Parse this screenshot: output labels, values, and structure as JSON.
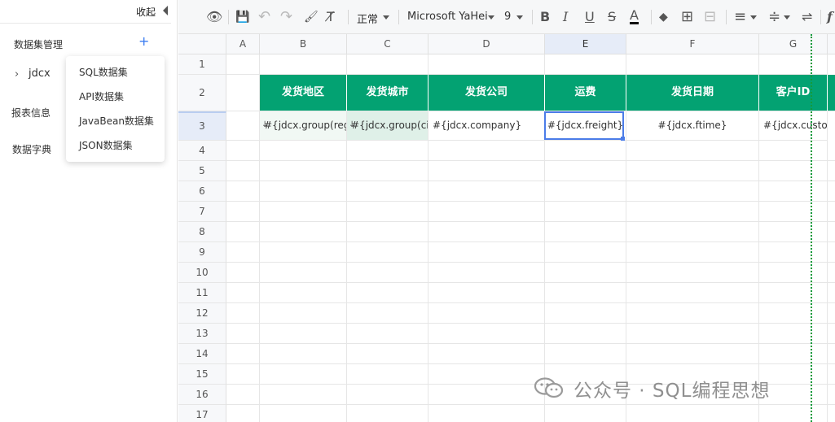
{
  "left_panel": {
    "collapse_label": "收起",
    "dataset_manage_title": "数据集管理",
    "add_icon": "+",
    "tree_chevron": "›",
    "tree_item": "jdcx",
    "report_info_title": "报表信息",
    "data_dict_title": "数据字典",
    "add_menu": [
      "SQL数据集",
      "API数据集",
      "JavaBean数据集",
      "JSON数据集"
    ]
  },
  "toolbar": {
    "icons": {
      "preview": "eye-icon",
      "save": "save-icon",
      "undo": "undo-icon",
      "redo": "redo-icon",
      "format_painter": "paint-format-icon",
      "clear_format": "clear-format-icon",
      "bold": "bold-icon",
      "italic": "italic-icon",
      "underline": "underline-icon",
      "strikethrough": "strikethrough-icon",
      "font_color": "font-color-icon",
      "fill_color": "fill-color-icon",
      "border": "border-icon",
      "merge": "merge-cells-icon",
      "align": "align-icon",
      "valign": "vertical-align-icon",
      "wrap": "text-wrap-icon",
      "function": "function-icon"
    },
    "style_select": "正常",
    "font_select": "Microsoft YaHei",
    "size_select": "9",
    "glyphs": {
      "eye": "👁",
      "save": "💾",
      "undo": "↶",
      "redo": "↷",
      "painter": "🖌",
      "clear": "T̸",
      "bold": "B",
      "italic": "I",
      "underline": "U",
      "strike": "S",
      "fontcolor": "A",
      "fill": "◆",
      "border": "⊞",
      "merge": "⊟",
      "align": "≡",
      "valign": "≑",
      "wrap": "⇌",
      "fx": "f"
    }
  },
  "grid": {
    "columns": [
      "A",
      "B",
      "C",
      "D",
      "E",
      "F",
      "G"
    ],
    "active_column": "E",
    "rows": [
      "1",
      "2",
      "3",
      "4",
      "5",
      "6",
      "7",
      "8",
      "9",
      "10",
      "11",
      "12",
      "13",
      "14",
      "15",
      "16",
      "17"
    ],
    "active_row": "3",
    "header_row": [
      "发货地区",
      "发货城市",
      "发货公司",
      "运费",
      "发货日期",
      "客户ID"
    ],
    "field_row": [
      "#{jdcx.group(reg",
      "#{jdcx.group(cit",
      "#{jdcx.company}",
      "#{jdcx.freight}",
      "#{jdcx.ftime}",
      "#{jdcx.custo"
    ],
    "expand_mark": "↓",
    "header_color": "#03a272",
    "selection_color": "#4b7ce8",
    "highlight_fill": "#dff0e8"
  },
  "watermark": {
    "text": "公众号 · SQL编程思想",
    "icon": "wechat-icon"
  }
}
